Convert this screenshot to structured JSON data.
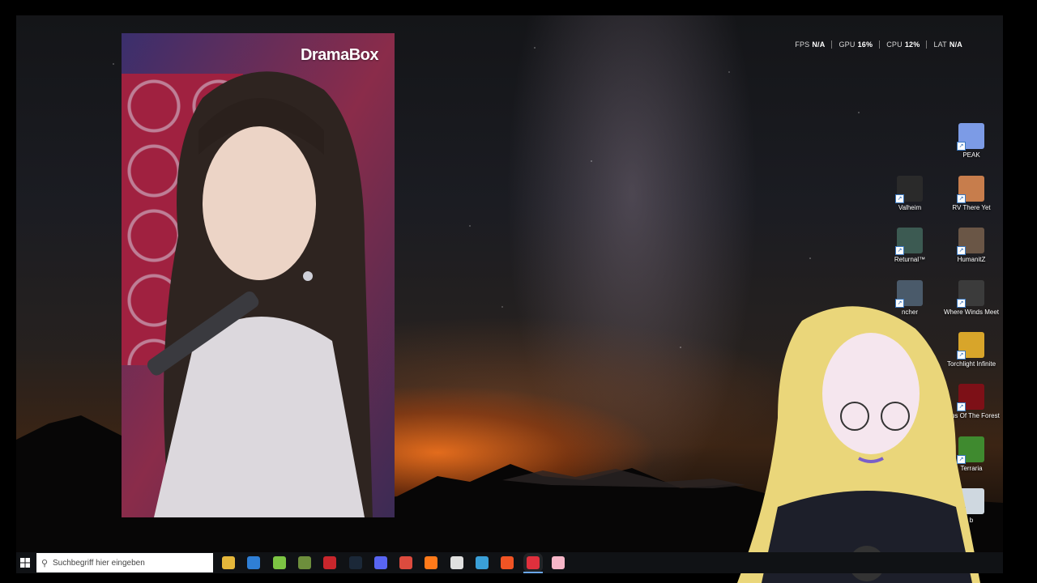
{
  "overlay": {
    "fps_label": "FPS",
    "fps_value": "N/A",
    "gpu_label": "GPU",
    "gpu_value": "16%",
    "cpu_label": "CPU",
    "cpu_value": "12%",
    "lat_label": "LAT",
    "lat_value": "N/A"
  },
  "video": {
    "brand": "DramaBox"
  },
  "desktop_icons": [
    {
      "label": "PEAK",
      "icon": "peak-icon",
      "color": "#7c9be6"
    },
    {
      "label": "Valheim",
      "icon": "valheim-icon",
      "color": "#2a2a2a"
    },
    {
      "label": "RV There Yet",
      "icon": "rv-there-yet-icon",
      "color": "#c77d4c"
    },
    {
      "label": "Returnal™",
      "icon": "returnal-icon",
      "color": "#3c5a52"
    },
    {
      "label": "HumanitZ",
      "icon": "humanitz-icon",
      "color": "#6a5646"
    },
    {
      "label": "ncher",
      "icon": "launcher-icon",
      "color": "#4a5a6a"
    },
    {
      "label": "Where Winds Meet",
      "icon": "where-winds-meet-icon",
      "color": "#3b3b3b"
    },
    {
      "label": "Torchlight Infinite",
      "icon": "torchlight-icon",
      "color": "#d8a52a"
    },
    {
      "label": "Sons Of The Forest",
      "icon": "sons-of-the-forest-icon",
      "color": "#7d1017"
    },
    {
      "label": "Terraria",
      "icon": "terraria-icon",
      "color": "#3f8a2f"
    },
    {
      "label": "b",
      "icon": "recycle-bin-icon",
      "color": "#cfd8e0"
    }
  ],
  "taskbar": {
    "search_placeholder": "Suchbegriff hier eingeben",
    "apps": [
      {
        "name": "file-explorer-icon",
        "color": "#e5b73b"
      },
      {
        "name": "microsoft-store-icon",
        "color": "#2f7fd6"
      },
      {
        "name": "android-icon",
        "color": "#7cc443"
      },
      {
        "name": "minecraft-icon",
        "color": "#6d8e3c"
      },
      {
        "name": "game-launcher-icon",
        "color": "#c8262c"
      },
      {
        "name": "steam-icon",
        "color": "#1b2838"
      },
      {
        "name": "discord-icon",
        "color": "#5865f2"
      },
      {
        "name": "chrome-icon",
        "color": "#dc4b3e"
      },
      {
        "name": "firefox-icon",
        "color": "#ff7a1a"
      },
      {
        "name": "speedometer-icon",
        "color": "#e0e0e0"
      },
      {
        "name": "sync-icon",
        "color": "#3aa0d8"
      },
      {
        "name": "brave-icon",
        "color": "#f05424"
      },
      {
        "name": "obs-opera-icon",
        "color": "#e0303d"
      },
      {
        "name": "vtuber-app-icon",
        "color": "#f6b6c8"
      }
    ]
  }
}
